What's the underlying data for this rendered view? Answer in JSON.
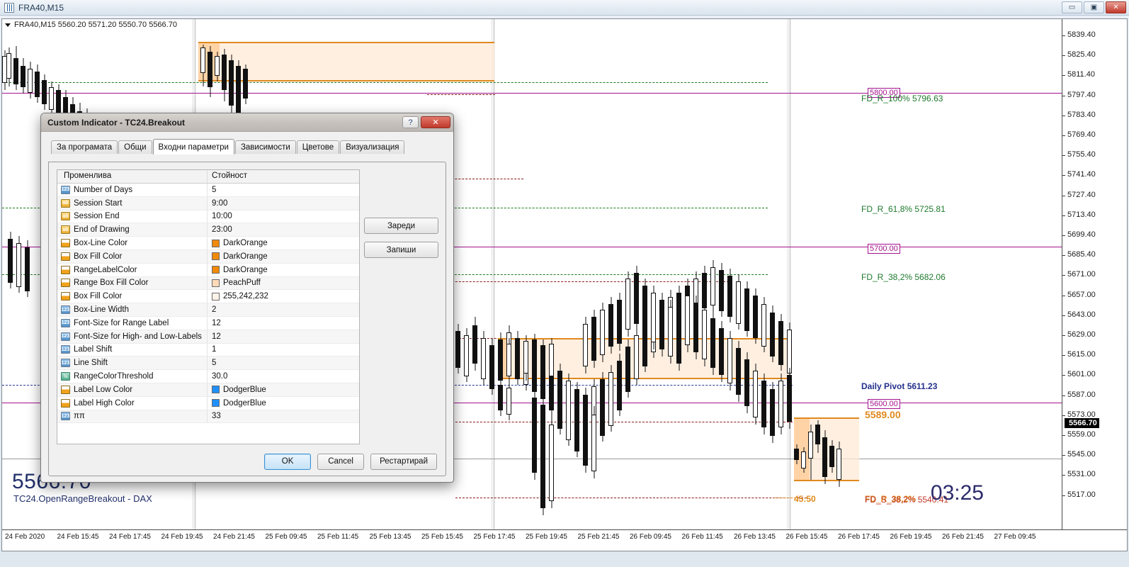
{
  "window": {
    "title": "FRA40,M15",
    "icon": "chart-icon",
    "buttons": {
      "minimize": "—",
      "maximize": "❐",
      "close": "✕"
    }
  },
  "chart": {
    "header": "FRA40,M15  5560.20 5571.20 5550.70 5566.70",
    "symbol_price": "5566.70",
    "indicator_label": "TC24.OpenRangeBreakout - DAX",
    "clock": "03:25",
    "current_price_tag": "5566.70",
    "price_ticks": [
      "5839.40",
      "5825.40",
      "5811.40",
      "5797.40",
      "5783.40",
      "5769.40",
      "5755.40",
      "5741.40",
      "5727.40",
      "5713.40",
      "5699.40",
      "5685.40",
      "5671.00",
      "5657.00",
      "5643.00",
      "5629.00",
      "5615.00",
      "5601.00",
      "5587.00",
      "5573.00",
      "5559.00",
      "5545.00",
      "5531.00",
      "5517.00"
    ],
    "time_ticks": [
      "24 Feb 2020",
      "24 Feb 15:45",
      "24 Feb 17:45",
      "24 Feb 19:45",
      "24 Feb 21:45",
      "25 Feb 09:45",
      "25 Feb 11:45",
      "25 Feb 13:45",
      "25 Feb 15:45",
      "25 Feb 17:45",
      "25 Feb 19:45",
      "25 Feb 21:45",
      "26 Feb 09:45",
      "26 Feb 11:45",
      "26 Feb 13:45",
      "26 Feb 15:45",
      "26 Feb 17:45",
      "26 Feb 19:45",
      "26 Feb 21:45",
      "27 Feb 09:45"
    ],
    "annotations": [
      {
        "name": "level-5800",
        "text": "5800.00",
        "style": "boxed-magenta"
      },
      {
        "name": "fib-r-100",
        "text": "FD_R_100% 5796.63",
        "style": "green"
      },
      {
        "name": "fib-r-618",
        "text": "FD_R_61,8% 5725.81",
        "style": "green"
      },
      {
        "name": "level-5700",
        "text": "5700.00",
        "style": "boxed-magenta"
      },
      {
        "name": "fib-r-382",
        "text": "FD_R_38,2% 5682.06",
        "style": "green"
      },
      {
        "name": "daily-pivot",
        "text": "Daily Pivot 5611.23",
        "style": "navy"
      },
      {
        "name": "level-5600",
        "text": "5600.00",
        "style": "boxed-magenta"
      },
      {
        "name": "range-high",
        "text": "5589.00",
        "style": "orange"
      },
      {
        "name": "range-time",
        "text": "45:50",
        "style": "orange-small"
      },
      {
        "name": "fib-overlap-orange",
        "text": "FD_R_38,2%",
        "style": "orange-small"
      },
      {
        "name": "fib-overlap-red",
        "text": "FD_S_38,2%  5540.41",
        "style": "red"
      }
    ],
    "colors": {
      "box_line": "#e08a1e",
      "box_fill": "#ffd6ad",
      "pivot_level": "#a3138f",
      "fib_green": "#1f7a2e",
      "fib_red": "#8b1a1a",
      "daily_pivot": "#23308c",
      "candle_up": "#ffffff",
      "candle_down": "#111111"
    }
  },
  "dialog": {
    "title": "Custom Indicator - TC24.Breakout",
    "help_button": "?",
    "close_button": "✕",
    "tabs": [
      {
        "label": "За програмата",
        "active": false
      },
      {
        "label": "Общи",
        "active": false
      },
      {
        "label": "Входни параметри",
        "active": true
      },
      {
        "label": "Зависимости",
        "active": false
      },
      {
        "label": "Цветове",
        "active": false
      },
      {
        "label": "Визуализация",
        "active": false
      }
    ],
    "grid": {
      "headers": [
        "Променлива",
        "Стойност"
      ],
      "rows": [
        {
          "icon": "integer-icon",
          "name": "Number of Days",
          "value": "5",
          "swatch": null
        },
        {
          "icon": "string-icon",
          "name": "Session Start",
          "value": "9:00",
          "swatch": null
        },
        {
          "icon": "string-icon",
          "name": "Session End",
          "value": "10:00",
          "swatch": null
        },
        {
          "icon": "string-icon",
          "name": "End of Drawing",
          "value": "23:00",
          "swatch": null
        },
        {
          "icon": "color-icon",
          "name": "Box-Line Color",
          "value": "DarkOrange",
          "swatch": "#ef8a0c"
        },
        {
          "icon": "color-icon",
          "name": "Box Fill Color",
          "value": "DarkOrange",
          "swatch": "#ef8a0c"
        },
        {
          "icon": "color-icon",
          "name": "RangeLabelColor",
          "value": "DarkOrange",
          "swatch": "#ef8a0c"
        },
        {
          "icon": "color-icon",
          "name": "Range Box Fill Color",
          "value": "PeachPuff",
          "swatch": "#ffdab9"
        },
        {
          "icon": "color-icon",
          "name": "Box Fill Color",
          "value": "255,242,232",
          "swatch": "#fff2e8"
        },
        {
          "icon": "integer-icon",
          "name": "Box-Line Width",
          "value": "2",
          "swatch": null
        },
        {
          "icon": "integer-icon",
          "name": "Font-Size for Range Label",
          "value": "12",
          "swatch": null
        },
        {
          "icon": "integer-icon",
          "name": "Font-Size for High- and Low-Labels",
          "value": "12",
          "swatch": null
        },
        {
          "icon": "integer-icon",
          "name": "Label Shift",
          "value": "1",
          "swatch": null
        },
        {
          "icon": "integer-icon",
          "name": "Line Shift",
          "value": "5",
          "swatch": null
        },
        {
          "icon": "double-icon",
          "name": "RangeColorThreshold",
          "value": "30.0",
          "swatch": null
        },
        {
          "icon": "color-icon",
          "name": "Label Low Color",
          "value": "DodgerBlue",
          "swatch": "#1e90ff"
        },
        {
          "icon": "color-icon",
          "name": "Label High Color",
          "value": "DodgerBlue",
          "swatch": "#1e90ff"
        },
        {
          "icon": "integer-icon",
          "name": "ππ",
          "value": "33",
          "swatch": null
        }
      ]
    },
    "side_buttons": [
      {
        "label": "Зареди",
        "name": "load-button"
      },
      {
        "label": "Запиши",
        "name": "save-button"
      }
    ],
    "footer_buttons": [
      {
        "label": "OK",
        "name": "ok-button",
        "primary": true
      },
      {
        "label": "Cancel",
        "name": "cancel-button",
        "primary": false
      },
      {
        "label": "Рестартирай",
        "name": "restart-button",
        "primary": false
      }
    ]
  }
}
